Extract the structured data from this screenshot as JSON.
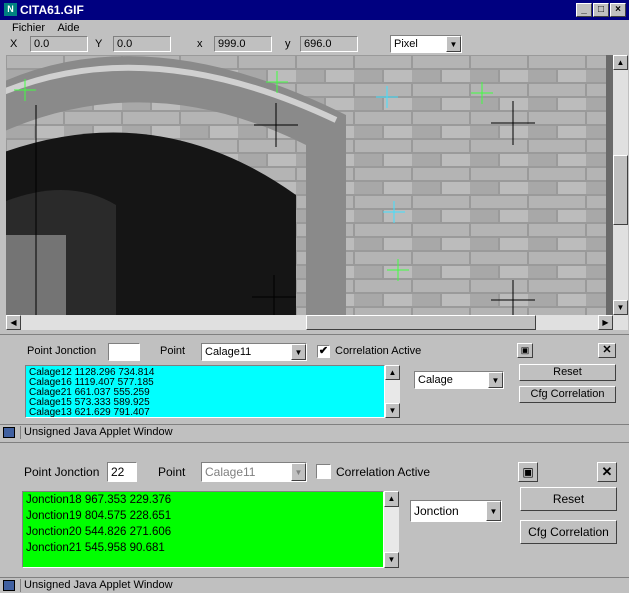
{
  "window": {
    "title": "CITA61.GIF",
    "min": "_",
    "max": "□",
    "close": "×"
  },
  "menu": {
    "items": [
      "Fichier",
      "Aide"
    ]
  },
  "coords": {
    "x_label": "X",
    "x": "0.0",
    "y_label": "Y",
    "y": "0.0",
    "x2_label": "x",
    "x2": "999.0",
    "y2_label": "y",
    "y2": "696.0",
    "unit": "Pixel"
  },
  "panel1": {
    "junction_label": "Point Jonction",
    "junction_value": "",
    "point_label": "Point",
    "point_value": "Calage11",
    "correlation_label": "Correlation Active",
    "correlation_checked": "✔",
    "list": [
      "Calage12 1128.296 734.814",
      "Calage16 1119.407 577.185",
      "Calage21 661.037 555.259",
      "Calage15 573.333 589.925",
      "Calage13 621.629 791.407"
    ],
    "type_value": "Calage",
    "reset": "Reset",
    "cfg": "Cfg Correlation"
  },
  "status1": {
    "text": "Unsigned Java Applet Window"
  },
  "panel2": {
    "junction_label": "Point Jonction",
    "junction_value": "22",
    "point_label": "Point",
    "point_value": "Calage11",
    "correlation_label": "Correlation Active",
    "correlation_checked": "",
    "list": [
      "Jonction18 967.353 229.376",
      "Jonction19 804.575 228.651",
      "Jonction20 544.826 271.606",
      "Jonction21 545.958 90.681"
    ],
    "type_value": "Jonction",
    "reset": "Reset",
    "cfg": "Cfg Correlation"
  },
  "status2": {
    "text": "Unsigned Java Applet Window"
  },
  "colors": {
    "list1": "#00ffff",
    "list2": "#00ff00",
    "titlebar": "#000080"
  }
}
